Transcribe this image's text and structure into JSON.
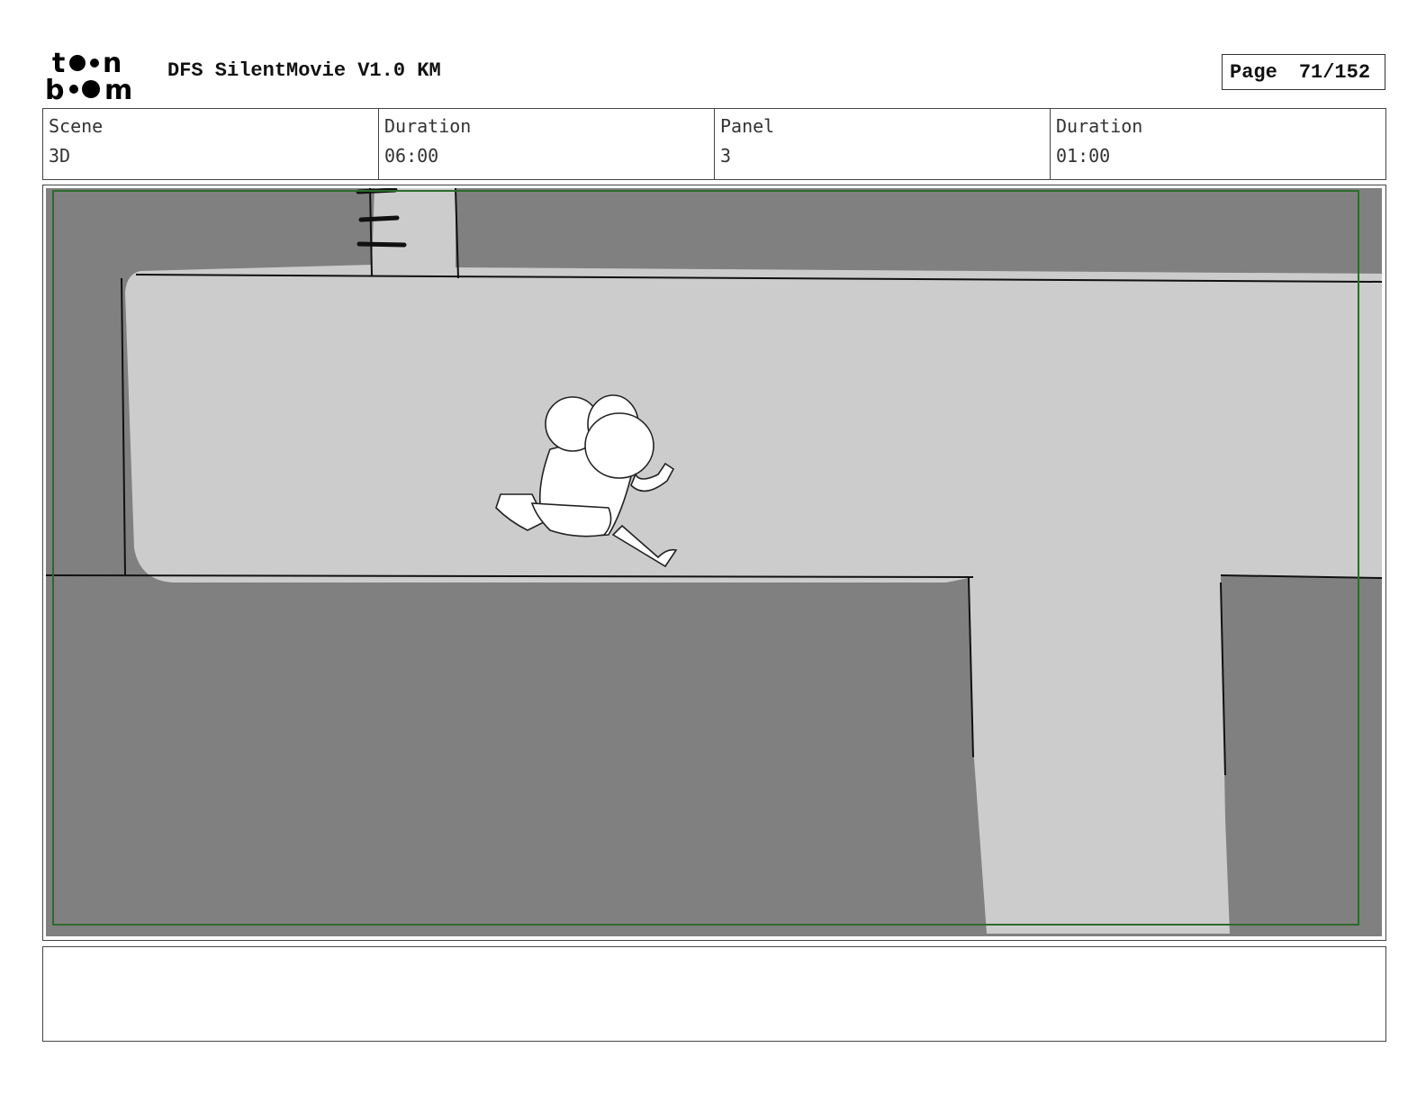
{
  "header": {
    "logo_text": "toon boom",
    "doc_title": "DFS SilentMovie V1.0 KM",
    "page_label": "Page",
    "page_number": "71/152"
  },
  "info": {
    "scene_label": "Scene",
    "scene_value": "3D",
    "scene_duration_label": "Duration",
    "scene_duration_value": "06:00",
    "panel_label": "Panel",
    "panel_value": "3",
    "panel_duration_label": "Duration",
    "panel_duration_value": "01:00"
  },
  "panel": {
    "safe_frame_color": "#2d6a2d",
    "wall_color": "#808080",
    "floor_color": "#cccccc"
  },
  "notes": {
    "text": ""
  }
}
